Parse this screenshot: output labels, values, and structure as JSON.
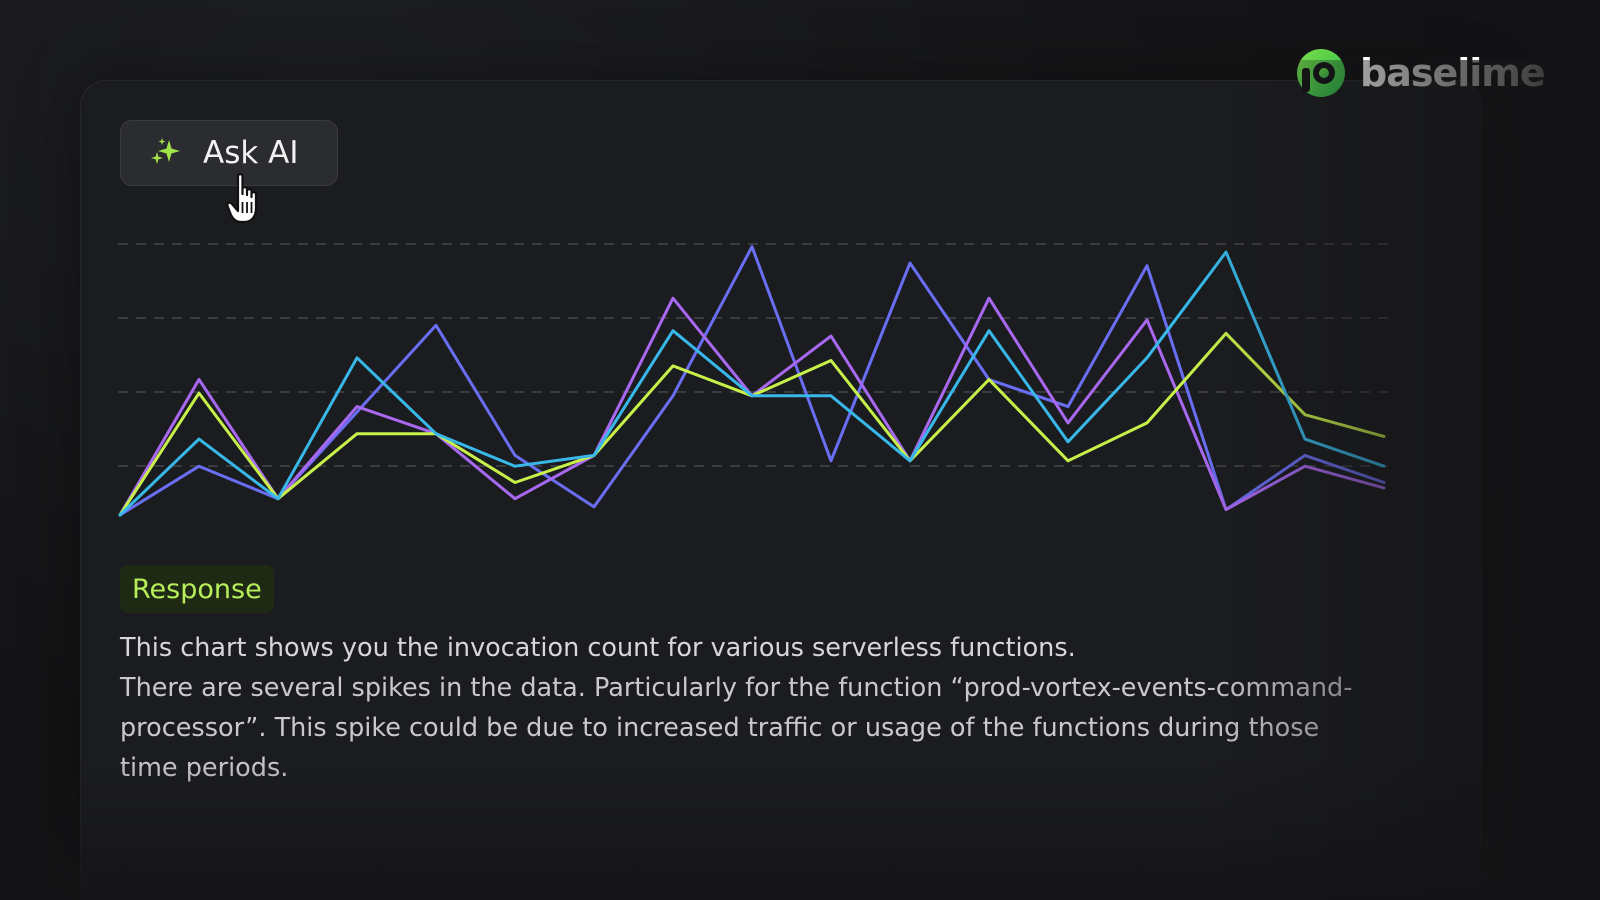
{
  "brand": {
    "name": "baselime",
    "accent": "#4fd04a"
  },
  "ask_button": {
    "label": "Ask AI",
    "icon": "sparkles-icon",
    "icon_color": "#9fe24a"
  },
  "cursor": {
    "icon": "hand-pointer-icon"
  },
  "chart_data": {
    "type": "line",
    "title": "",
    "xlabel": "",
    "ylabel": "",
    "x": [
      1,
      2,
      3,
      4,
      5,
      6,
      7,
      8,
      9,
      10,
      11,
      12,
      13,
      14,
      15,
      16,
      17,
      18
    ],
    "ylim": [
      0,
      100
    ],
    "grid": "horizontal dashed",
    "series": [
      {
        "color": "#6a6ef2",
        "values": [
          0,
          18,
          6,
          38,
          70,
          22,
          3,
          44,
          99,
          20,
          93,
          50,
          40,
          92,
          2,
          22,
          12
        ]
      },
      {
        "color": "#a868f0",
        "values": [
          0,
          50,
          6,
          40,
          30,
          6,
          22,
          80,
          44,
          66,
          20,
          80,
          34,
          72,
          2,
          18,
          10
        ]
      },
      {
        "color": "#c8f04a",
        "values": [
          0,
          45,
          6,
          30,
          30,
          12,
          22,
          55,
          44,
          57,
          20,
          50,
          20,
          34,
          67,
          37,
          29
        ]
      },
      {
        "color": "#38b8e8",
        "values": [
          0,
          28,
          6,
          58,
          30,
          18,
          22,
          68,
          44,
          44,
          20,
          68,
          27,
          58,
          97,
          28,
          18
        ]
      }
    ]
  },
  "response": {
    "badge": "Response",
    "line1": "This chart shows you the invocation count for various serverless functions.",
    "line2": "There are several spikes in the data. Particularly for the function “prod-vortex-events-command-processor”. This spike could be due to increased traffic or usage of the functions during those time periods."
  }
}
